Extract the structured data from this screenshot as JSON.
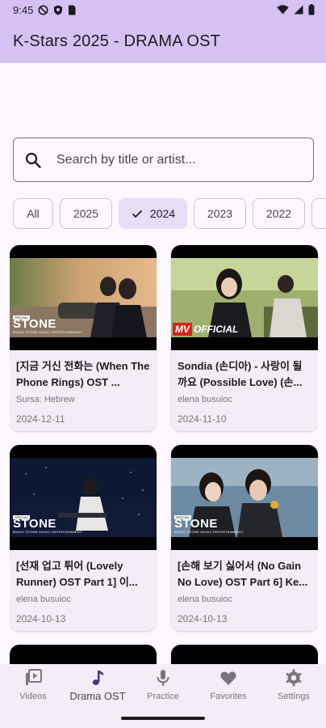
{
  "status_bar": {
    "time": "9:45"
  },
  "app_bar": {
    "title": "K-Stars 2025 - DRAMA OST"
  },
  "search": {
    "placeholder": "Search by title or artist..."
  },
  "filters": {
    "chips": [
      {
        "label": "All",
        "selected": false
      },
      {
        "label": "2025",
        "selected": false
      },
      {
        "label": "2024",
        "selected": true
      },
      {
        "label": "2023",
        "selected": false
      },
      {
        "label": "2022",
        "selected": false
      }
    ]
  },
  "cards": [
    {
      "title": "[지금 거신 전화는 (When The Phone Rings) OST ...",
      "artist": "Sursa: Hebrew",
      "date": "2024-12-11",
      "thumb_badge_main": "STONE",
      "thumb_badge_sub": "MUSIC STONE MUSIC ENTERTAINMENT",
      "thumb_badge_tag": "SPECIAL"
    },
    {
      "title": "Sondia (손디아) - 사랑이 될까요 (Possible Love) (손...",
      "artist": "elena busuioc",
      "date": "2024-11-10",
      "thumb_badge_mv": "MV",
      "thumb_badge_official": "OFFICIAL"
    },
    {
      "title": "[선재 업고 튀어 (Lovely Runner) OST Part 1] 이...",
      "artist": "elena busuioc",
      "date": "2024-10-13",
      "thumb_badge_main": "STONE",
      "thumb_badge_sub": "MUSIC STONE MUSIC ENTERTAINMENT",
      "thumb_badge_tag": "SPECIAL"
    },
    {
      "title": "[손해 보기 싫어서 (No Gain No Love) OST Part 6] Ke...",
      "artist": "elena busuioc",
      "date": "2024-10-13",
      "thumb_badge_main": "STONE",
      "thumb_badge_sub": "MUSIC STONE MUSIC ENTERTAINMENT",
      "thumb_badge_tag": "SPECIAL"
    }
  ],
  "bottom_nav": {
    "items": [
      {
        "label": "Videos",
        "icon": "video-library-icon",
        "active": false
      },
      {
        "label": "Drama OST",
        "icon": "music-note-icon",
        "active": true
      },
      {
        "label": "Practice",
        "icon": "microphone-icon",
        "active": false
      },
      {
        "label": "Favorites",
        "icon": "heart-icon",
        "active": false
      },
      {
        "label": "Settings",
        "icon": "gear-icon",
        "active": false
      }
    ]
  },
  "colors": {
    "app_bar": "#d6c1f2",
    "background": "#fdf7ff",
    "chip_selected": "#e8def8",
    "card": "#f3edf7",
    "nav_active_icon": "#4a3a74"
  }
}
